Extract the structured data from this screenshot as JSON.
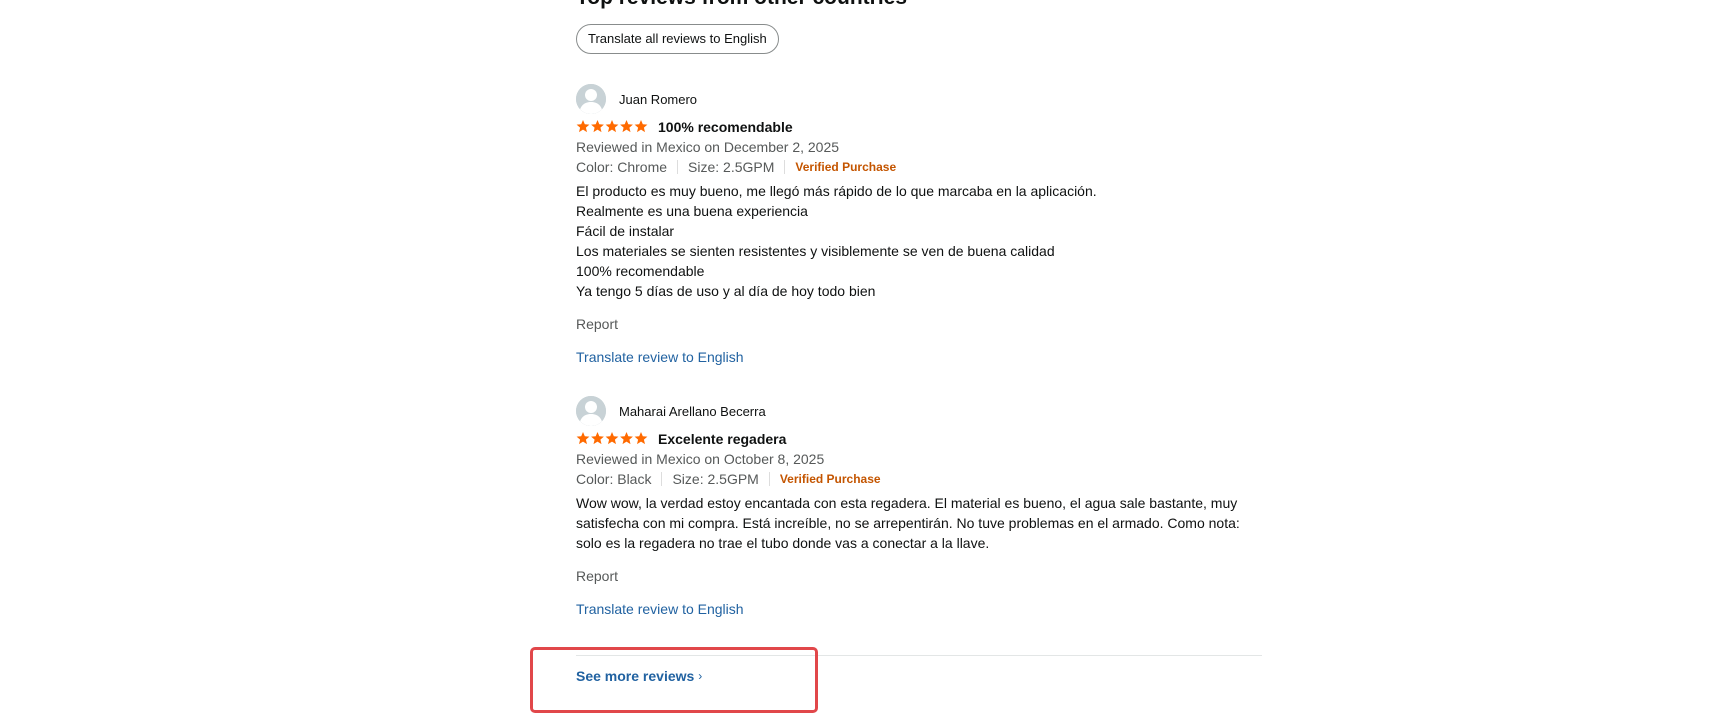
{
  "section": {
    "title": "Top reviews from other countries",
    "translate_all_label": "Translate all reviews to English"
  },
  "colors": {
    "star": "#ff6a00",
    "verified": "#c45500",
    "link": "#2162a1",
    "highlight": "#e1474a"
  },
  "reviews": [
    {
      "author": "Juan Romero",
      "rating": 5,
      "title": "100% recomendable",
      "date": "Reviewed in Mexico on December 2, 2025",
      "color": "Color: Chrome",
      "size": "Size: 2.5GPM",
      "verified": "Verified Purchase",
      "body": [
        "El producto es muy bueno, me llegó más rápido de lo que marcaba en la aplicación.",
        "Realmente es una buena experiencia",
        "Fácil de instalar",
        "Los materiales se sienten resistentes y visiblemente se ven de buena calidad",
        "100% recomendable",
        "Ya tengo 5 días de uso y al día de hoy todo bien"
      ],
      "report": "Report",
      "translate": "Translate review to English"
    },
    {
      "author": "Maharai Arellano Becerra",
      "rating": 5,
      "title": "Excelente regadera",
      "date": "Reviewed in Mexico on October 8, 2025",
      "color": "Color: Black",
      "size": "Size: 2.5GPM",
      "verified": "Verified Purchase",
      "body": [
        "Wow wow, la verdad estoy encantada con esta regadera. El material es bueno, el agua sale bastante, muy",
        "satisfecha con mi compra. Está increíble, no se arrepentirán. No tuve problemas en el armado. Como nota:",
        "solo es la regadera no trae el tubo donde vas a conectar a la llave."
      ],
      "report": "Report",
      "translate": "Translate review to English"
    }
  ],
  "footer": {
    "see_more_label": "See more reviews",
    "chevron": "›"
  }
}
